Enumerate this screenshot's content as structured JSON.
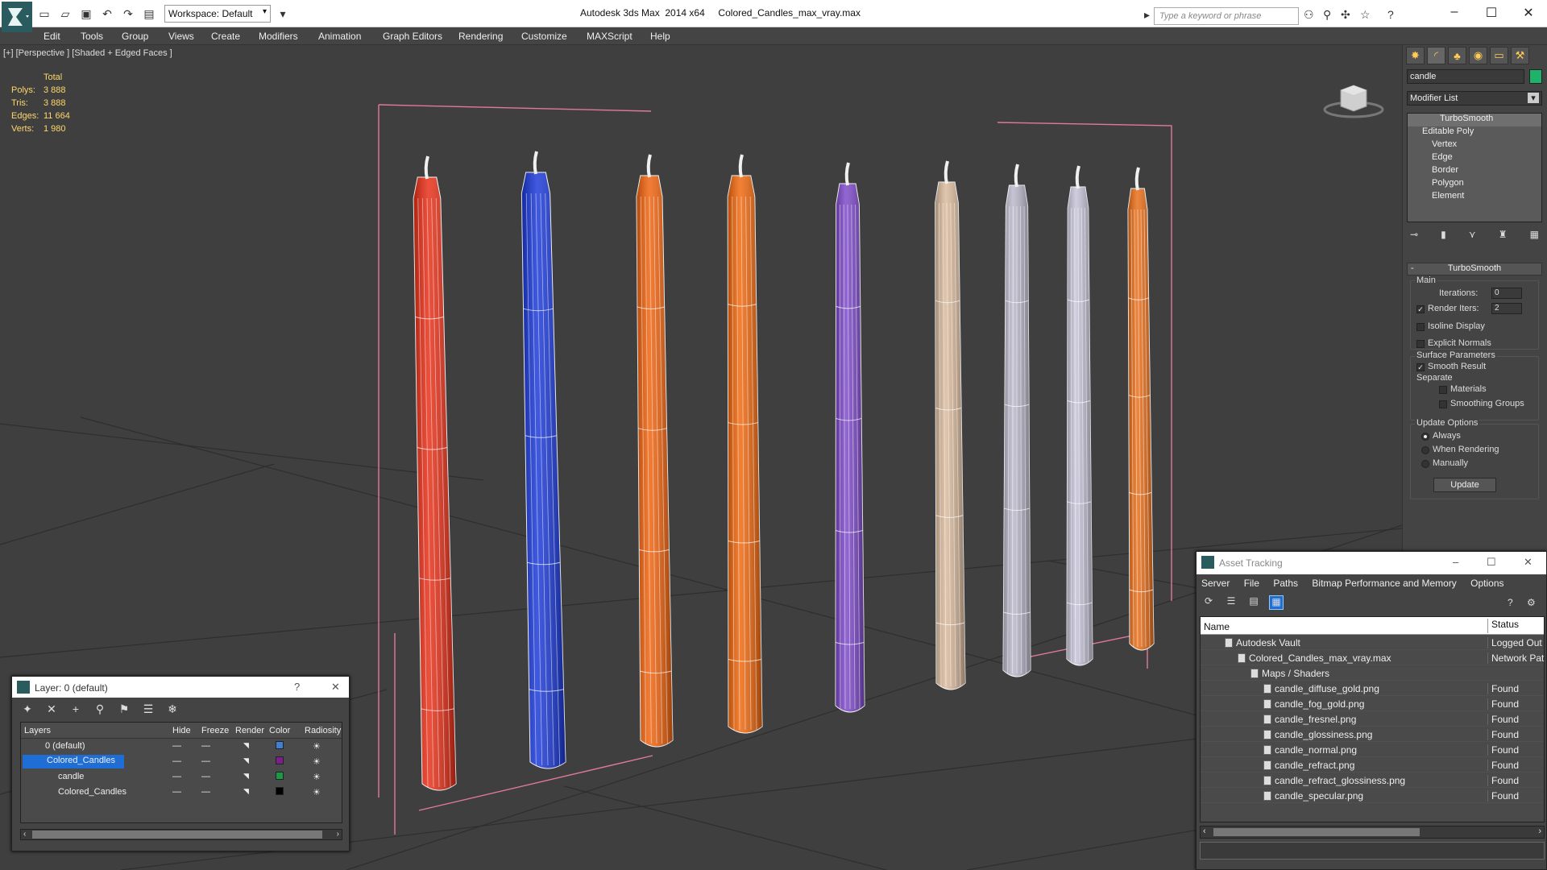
{
  "app": {
    "title": "Autodesk 3ds Max  2014 x64     Colored_Candles_max_vray.max",
    "workspace": "Workspace: Default",
    "search_placeholder": "Type a keyword or phrase"
  },
  "menu": [
    "Edit",
    "Tools",
    "Group",
    "Views",
    "Create",
    "Modifiers",
    "Animation",
    "Graph Editors",
    "Rendering",
    "Customize",
    "MAXScript",
    "Help"
  ],
  "viewport": {
    "label": "[+] [Perspective ] [Shaded + Edged Faces ]",
    "stats_header": "Total",
    "stats": [
      {
        "k": "Polys:",
        "v": "3 888"
      },
      {
        "k": "Tris:",
        "v": "3 888"
      },
      {
        "k": "Edges:",
        "v": "11 664"
      },
      {
        "k": "Verts:",
        "v": "1 980"
      }
    ],
    "candle_colors": [
      "#e62a12",
      "#1534d6",
      "#ef5f08",
      "#ef6408",
      "#7a45c8",
      "#d8b89a",
      "#b9b6c9",
      "#c4c2d6",
      "#e86a12"
    ]
  },
  "command_panel": {
    "object_name": "candle",
    "object_color": "#1db36a",
    "modifier_list": "Modifier List",
    "stack": [
      {
        "label": "TurboSmooth",
        "level": 0,
        "selected": true
      },
      {
        "label": "Editable Poly",
        "level": 0
      },
      {
        "label": "Vertex",
        "level": 1
      },
      {
        "label": "Edge",
        "level": 1
      },
      {
        "label": "Border",
        "level": 1
      },
      {
        "label": "Polygon",
        "level": 1
      },
      {
        "label": "Element",
        "level": 1
      }
    ],
    "rollout_title": "TurboSmooth",
    "main_label": "Main",
    "iterations_label": "Iterations:",
    "iterations_value": "0",
    "render_iters_label": "Render Iters:",
    "render_iters_value": "2",
    "isoline_label": "Isoline Display",
    "explicit_label": "Explicit Normals",
    "surface_label": "Surface Parameters",
    "smooth_label": "Smooth Result",
    "separate_label": "Separate",
    "materials_label": "Materials",
    "smoothing_label": "Smoothing Groups",
    "update_label": "Update Options",
    "always_label": "Always",
    "when_rendering_label": "When Rendering",
    "manually_label": "Manually",
    "update_button": "Update"
  },
  "layer_window": {
    "title": "Layer: 0 (default)",
    "help": "?",
    "columns": [
      "Layers",
      "Hide",
      "Freeze",
      "Render",
      "Color",
      "Radiosity"
    ],
    "rows": [
      {
        "name": "0 (default)",
        "color": "#3f7fd6",
        "indent": 1
      },
      {
        "name": "Colored_Candles",
        "color": "#7a1f8c",
        "indent": 1,
        "selected": true
      },
      {
        "name": "candle",
        "color": "#1a9a45",
        "indent": 2
      },
      {
        "name": "Colored_Candles",
        "color": "#000000",
        "indent": 2
      }
    ]
  },
  "asset_window": {
    "title": "Asset Tracking",
    "menu": [
      "Server",
      "File",
      "Paths",
      "Bitmap Performance and Memory",
      "Options"
    ],
    "columns": {
      "name": "Name",
      "status": "Status"
    },
    "rows": [
      {
        "name": "Autodesk Vault",
        "status": "Logged Out",
        "indent": 1
      },
      {
        "name": "Colored_Candles_max_vray.max",
        "status": "Network Pat",
        "indent": 2
      },
      {
        "name": "Maps / Shaders",
        "status": "",
        "indent": 3
      },
      {
        "name": "candle_diffuse_gold.png",
        "status": "Found",
        "indent": 4
      },
      {
        "name": "candle_fog_gold.png",
        "status": "Found",
        "indent": 4
      },
      {
        "name": "candle_fresnel.png",
        "status": "Found",
        "indent": 4
      },
      {
        "name": "candle_glossiness.png",
        "status": "Found",
        "indent": 4
      },
      {
        "name": "candle_normal.png",
        "status": "Found",
        "indent": 4
      },
      {
        "name": "candle_refract.png",
        "status": "Found",
        "indent": 4
      },
      {
        "name": "candle_refract_glossiness.png",
        "status": "Found",
        "indent": 4
      },
      {
        "name": "candle_specular.png",
        "status": "Found",
        "indent": 4
      }
    ]
  }
}
